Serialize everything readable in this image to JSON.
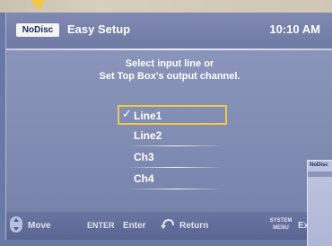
{
  "header": {
    "disc_status": "NoDisc",
    "title": "Easy Setup",
    "clock": "10:10 AM"
  },
  "instruction": {
    "line1": "Select input line or",
    "line2": "Set Top Box's output channel."
  },
  "options": [
    {
      "label": "Line1",
      "selected": true,
      "check": "✓"
    },
    {
      "label": "Line2",
      "selected": false
    },
    {
      "label": "Ch3",
      "selected": false
    },
    {
      "label": "Ch4",
      "selected": false
    }
  ],
  "footer": {
    "move": "Move",
    "enter_key": "ENTER",
    "enter": "Enter",
    "return": "Return",
    "system_menu_line1": "SYSTEM",
    "system_menu_line2": "MENU",
    "exit_partial": "Ex"
  },
  "mini_window": {
    "disc_status": "NoDisc"
  },
  "colors": {
    "highlight": "#f1c84a",
    "panel": "#8590b6",
    "text": "#ffffff"
  }
}
